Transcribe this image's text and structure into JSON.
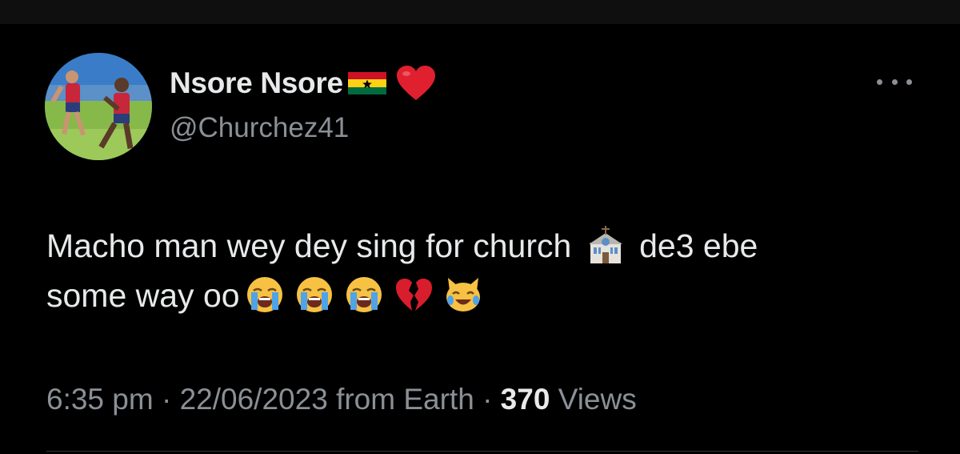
{
  "tweet": {
    "author": {
      "display_name": "Nsore Nsore",
      "handle": "@Churchez41",
      "name_emojis": [
        "ghana-flag",
        "red-heart"
      ]
    },
    "text": {
      "line1_part1": "Macho man wey dey sing for church",
      "line1_part2": "de3 ebe",
      "line2": "some way oo"
    },
    "text_emojis": [
      "church-icon",
      "loudly-crying-face",
      "loudly-crying-face",
      "loudly-crying-face",
      "broken-heart",
      "cat-tears-of-joy"
    ],
    "meta": {
      "time": "6:35 pm",
      "sep1": "·",
      "date": "22/06/2023",
      "source": "from Earth",
      "sep2": "·",
      "views_count": "370",
      "views_label": "Views"
    }
  },
  "colors": {
    "background": "#000000",
    "primary_text": "#e7e9ea",
    "secondary_text": "#8b9096"
  }
}
